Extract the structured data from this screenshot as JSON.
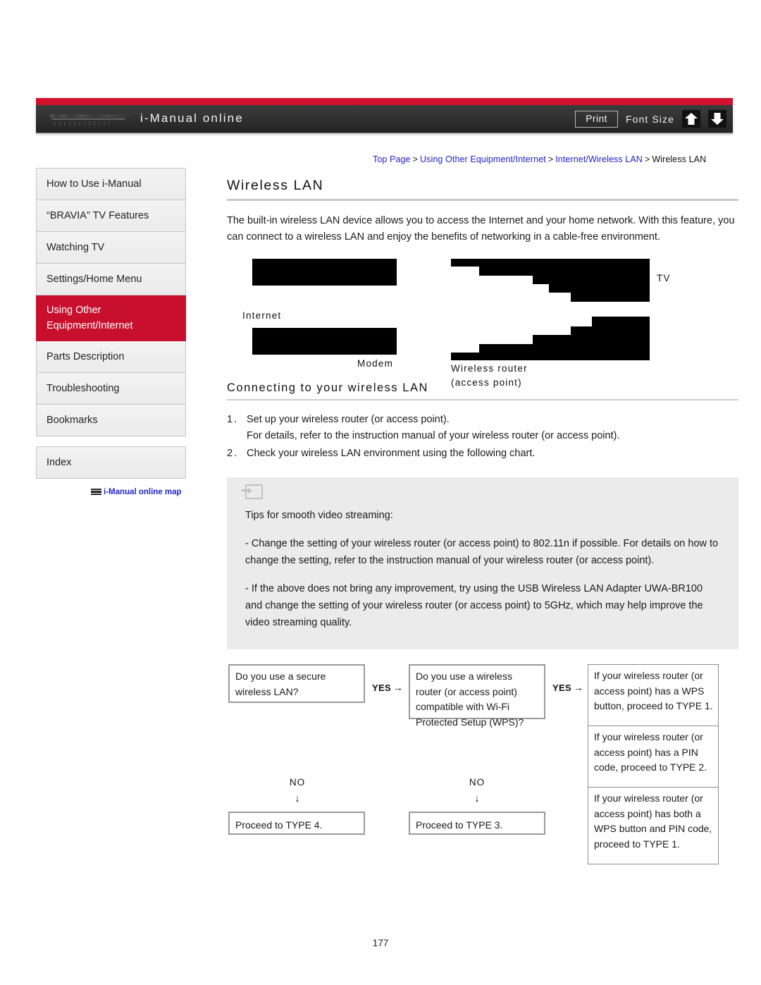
{
  "header": {
    "site_title": "i-Manual online",
    "brand_logo_name": "sony-logo",
    "print_label": "Print",
    "font_size_label": "Font Size",
    "font_increase_icon": "up-arrow-icon",
    "font_decrease_icon": "down-arrow-icon",
    "accent_color": "#d4112c",
    "bar_color": "#2e2e2e"
  },
  "breadcrumb": {
    "items": [
      {
        "label": "Top Page",
        "link": true
      },
      {
        "label": "Using Other Equipment/Internet",
        "link": true
      },
      {
        "label": "Internet/Wireless LAN",
        "link": true
      },
      {
        "label": "Wireless LAN",
        "link": false
      }
    ],
    "separator": ">"
  },
  "sidebar": {
    "items": [
      {
        "label": "How to Use i-Manual",
        "active": false
      },
      {
        "label": "“BRAVIA” TV Features",
        "active": false
      },
      {
        "label": "Watching TV",
        "active": false
      },
      {
        "label": "Settings/Home Menu",
        "active": false
      },
      {
        "label": "Using Other Equipment/Internet",
        "active": true
      },
      {
        "label": "Parts Description",
        "active": false
      },
      {
        "label": "Troubleshooting",
        "active": false
      },
      {
        "label": "Bookmarks",
        "active": false
      }
    ],
    "index_label": "Index",
    "sitemap_label": "i-Manual online map",
    "active_color": "#c8102e"
  },
  "main": {
    "title": "Wireless LAN",
    "intro": "The built-in wireless LAN device allows you to access the Internet and your home network. With this feature, you can connect to a wireless LAN and enjoy the benefits of networking in a cable-free environment.",
    "diagram": {
      "labels": {
        "internet": "Internet",
        "modem": "Modem",
        "router": "Wireless router",
        "router_sub": "(access point)",
        "tv": "TV"
      }
    },
    "section": {
      "title": "Connecting to your wireless LAN",
      "steps": [
        {
          "num": "1.",
          "lines": [
            "Set up your wireless router (or access point).",
            "For details, refer to the instruction manual of your wireless router (or access point)."
          ]
        },
        {
          "num": "2.",
          "lines": [
            "Check your wireless LAN environment using the following chart."
          ]
        }
      ]
    },
    "tips": {
      "icon": "tip-note-icon",
      "heading": "Tips for smooth video streaming:",
      "para1": "- Change the setting of your wireless router (or access point) to 802.11n if possible. For details on how to change the setting, refer to the instruction manual of your wireless router (or access point).",
      "para2": "- If the above does not bring any improvement, try using the USB Wireless LAN Adapter UWA-BR100 and change the setting of your wireless router (or access point) to 5GHz, which may help improve the video streaming quality."
    },
    "flowchart": {
      "q1": "Do you use a secure wireless LAN?",
      "q2": "Do you use a wireless router (or access point) compatible with Wi-Fi Protected Setup (WPS)?",
      "yes1": "YES",
      "yes2": "YES",
      "arrow_right": "→",
      "arrow_down": "↓",
      "no1": "NO",
      "no2": "NO",
      "result1": "If your wireless router (or access point) has a WPS button, proceed to TYPE 1.",
      "result2": "If your wireless router (or access point) has a PIN code, proceed to TYPE 2.",
      "result3": "If your wireless router (or access point) has both a WPS button and PIN code, proceed to TYPE 1.",
      "no1_result": "Proceed to TYPE 4.",
      "no2_result": "Proceed to TYPE 3."
    }
  },
  "footer": {
    "page_number": "177"
  }
}
